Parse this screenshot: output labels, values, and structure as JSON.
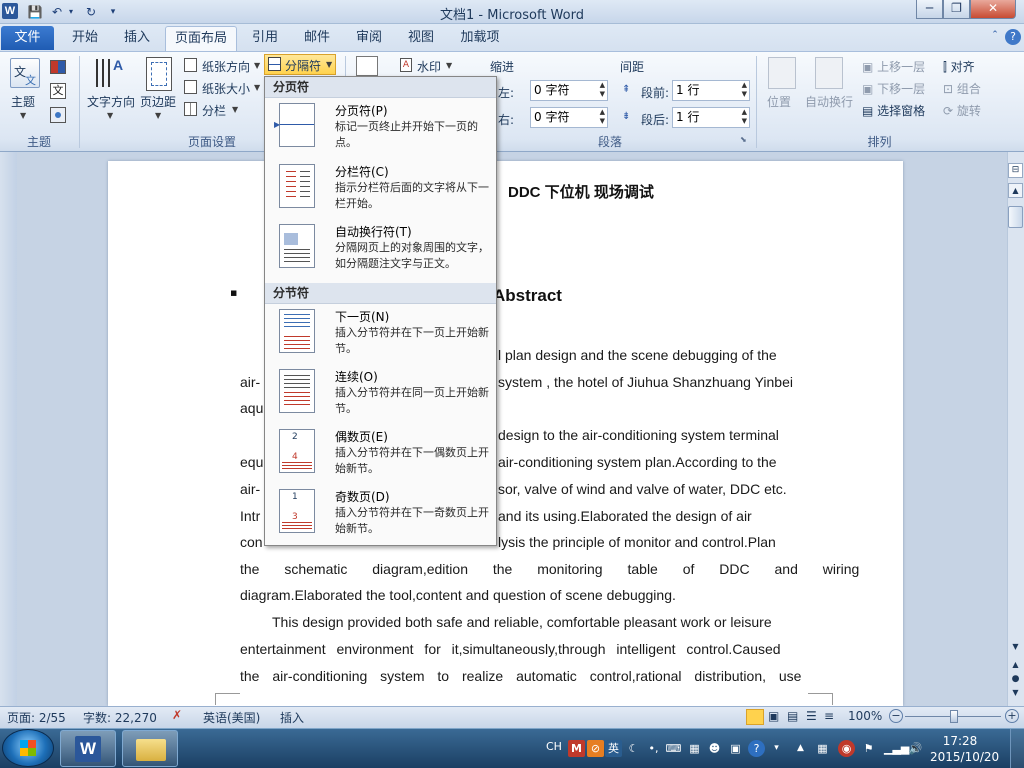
{
  "title_bar": {
    "title": "文档1  -  Microsoft Word",
    "app_icon_letter": "W",
    "minimize": "─",
    "restore": "❐",
    "close": "✕",
    "qat_save": "💾",
    "qat_undo": "↶",
    "qat_redo": "↻",
    "qat_more": "▾"
  },
  "tabs": {
    "file": "文件",
    "items": [
      "开始",
      "插入",
      "页面布局",
      "引用",
      "邮件",
      "审阅",
      "视图",
      "加载项"
    ],
    "active_index": 2
  },
  "ribbon": {
    "groups": {
      "theme": "主题",
      "page_setup": "页面设置",
      "paragraph": "段落",
      "arrange": "排列"
    },
    "theme_btn": "主题",
    "text_direction": "文字方向",
    "margins": "页边距",
    "orientation": "纸张方向",
    "size": "纸张大小",
    "columns": "分栏",
    "breaks": "分隔符",
    "watermark": "水印",
    "indent_title": "缩进",
    "indent_left_label": "左:",
    "indent_left_value": "0 字符",
    "indent_right_label": "右:",
    "indent_right_value": "0 字符",
    "spacing_title": "间距",
    "spacing_before_label": "段前:",
    "spacing_before_value": "1 行",
    "spacing_after_label": "段后:",
    "spacing_after_value": "1 行",
    "position": "位置",
    "wrap": "自动换行",
    "bring_forward": "上移一层",
    "send_backward": "下移一层",
    "selection_pane": "选择窗格",
    "align": "对齐",
    "group": "组合",
    "rotate": "旋转"
  },
  "breaks_menu": {
    "page_breaks_header": "分页符",
    "section_breaks_header": "分节符",
    "items": [
      {
        "title": "分页符(P)",
        "desc": "标记一页终止并开始下一页的点。"
      },
      {
        "title": "分栏符(C)",
        "desc": "指示分栏符后面的文字将从下一栏开始。"
      },
      {
        "title": "自动换行符(T)",
        "desc": "分隔网页上的对象周围的文字，如分隔题注文字与正文。"
      },
      {
        "title": "下一页(N)",
        "desc": "插入分节符并在下一页上开始新节。"
      },
      {
        "title": "连续(O)",
        "desc": "插入分节符并在同一页上开始新节。"
      },
      {
        "title": "偶数页(E)",
        "desc": "插入分节符并在下一偶数页上开始新节。"
      },
      {
        "title": "奇数页(D)",
        "desc": "插入分节符并在下一奇数页上开始新节。"
      }
    ]
  },
  "document": {
    "heading": "DDC  下位机  现场调试",
    "abstract": "Abstract",
    "lines": [
      "l plan design and the scene debugging of the",
      "system , the hotel of Jiuhua Shanzhuang Yinbei",
      "design to the air-conditioning system terminal",
      "air-conditioning system plan.According to the",
      "sor, valve of wind and valve of water, DDC etc.",
      "and its using.Elaborated the design of air",
      "lysis the principle of monitor and control.Plan",
      "the schematic diagram,edition the monitoring table of DDC and wiring",
      "diagram.Elaborated the tool,content and question of scene debugging.",
      "This design provided both safe and reliable, comfortable pleasant work or leisure",
      "entertainment environment for it,simultaneously,through intelligent control.Caused",
      "the air-conditioning system to realize automatic control,rational distribution, use"
    ],
    "left_frag": [
      "air-",
      "aqu",
      "equ",
      "air-",
      "Intr",
      "con"
    ],
    "bullet": "▪"
  },
  "status_bar": {
    "page": "页面: 2/55",
    "words": "字数: 22,270",
    "language": "英语(美国)",
    "mode": "插入",
    "zoom": "100%"
  },
  "taskbar": {
    "lang": "CH",
    "ime": "英",
    "time": "17:28",
    "date": "2015/10/20",
    "word_letter": "W"
  }
}
